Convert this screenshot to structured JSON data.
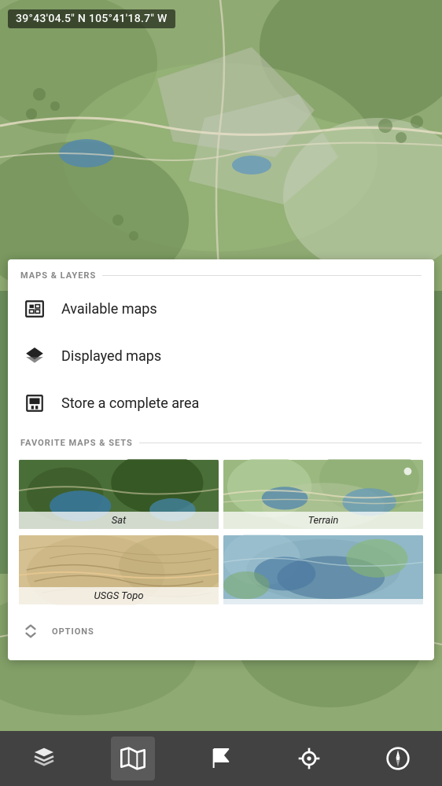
{
  "coordinates": {
    "text": "39°43'04.5\" N 105°41'18.7\" W"
  },
  "panel": {
    "maps_layers_label": "MAPS & LAYERS",
    "available_maps_label": "Available maps",
    "displayed_maps_label": "Displayed maps",
    "store_area_label": "Store a complete area",
    "favorite_maps_label": "FAVORITE MAPS & SETS",
    "options_label": "OPTIONS",
    "maps": [
      {
        "id": "sat",
        "label": "Sat"
      },
      {
        "id": "terrain",
        "label": "Terrain"
      },
      {
        "id": "usgs",
        "label": "USGS Topo"
      },
      {
        "id": "fourth",
        "label": ""
      }
    ]
  },
  "toolbar": {
    "buttons": [
      {
        "id": "layers",
        "label": "layers"
      },
      {
        "id": "map",
        "label": "map",
        "active": true
      },
      {
        "id": "flag",
        "label": "flag"
      },
      {
        "id": "location",
        "label": "location"
      },
      {
        "id": "compass",
        "label": "compass"
      }
    ]
  }
}
